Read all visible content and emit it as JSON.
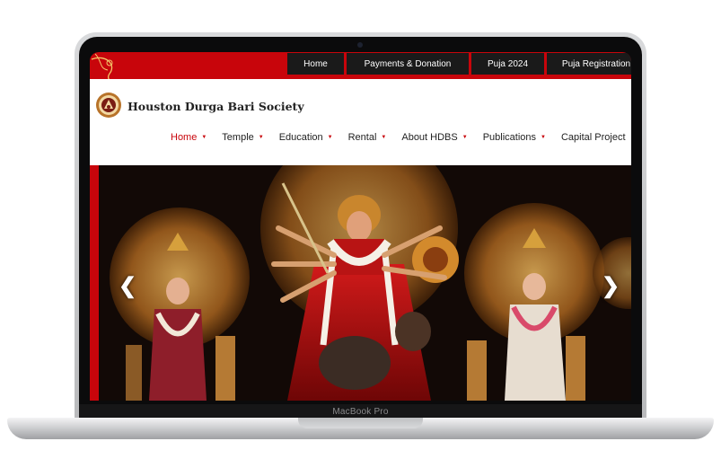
{
  "device": {
    "label": "MacBook Pro"
  },
  "topnav": [
    {
      "label": "Home"
    },
    {
      "label": "Payments & Donation"
    },
    {
      "label": "Puja 2024"
    },
    {
      "label": "Puja Registration"
    }
  ],
  "header": {
    "title": "Houston Durga Bari Society"
  },
  "mainnav": [
    {
      "label": "Home",
      "active": true
    },
    {
      "label": "Temple"
    },
    {
      "label": "Education"
    },
    {
      "label": "Rental"
    },
    {
      "label": "About HDBS"
    },
    {
      "label": "Publications"
    },
    {
      "label": "Capital Project"
    }
  ],
  "hero": {
    "prev_icon": "chevron-left-icon",
    "next_icon": "chevron-right-icon",
    "prev_glyph": "❮",
    "next_glyph": "❯"
  },
  "colors": {
    "brand_red": "#c8050b",
    "topnav_bg": "#1a1a1a",
    "gold": "#c8902a"
  }
}
